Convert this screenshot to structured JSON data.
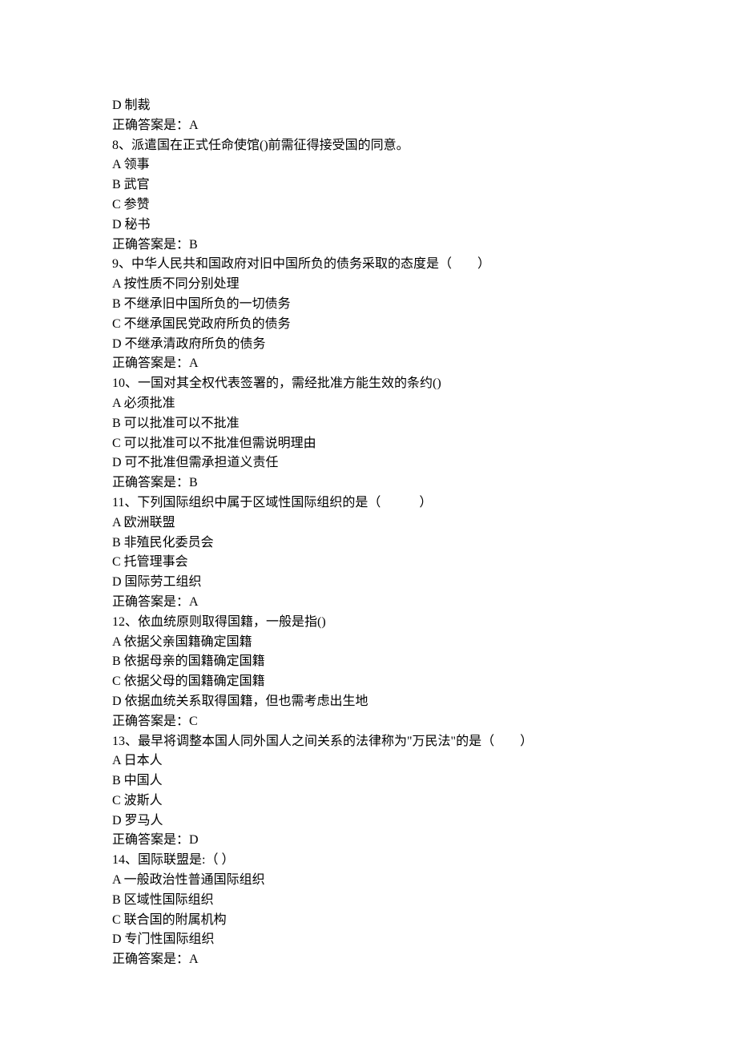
{
  "leading_lines": [
    "D 制裁",
    "正确答案是：A"
  ],
  "questions": [
    {
      "stem": "8、派遣国在正式任命使馆()前需征得接受国的同意。",
      "options": [
        "A 领事",
        "B 武官",
        "C 参赞",
        "D 秘书"
      ],
      "answer": "正确答案是：B"
    },
    {
      "stem": "9、中华人民共和国政府对旧中国所负的债务采取的态度是（　　）",
      "options": [
        "A 按性质不同分别处理",
        "B 不继承旧中国所负的一切债务",
        "C 不继承国民党政府所负的债务",
        "D 不继承清政府所负的债务"
      ],
      "answer": "正确答案是：A"
    },
    {
      "stem": "10、一国对其全权代表签署的，需经批准方能生效的条约()",
      "options": [
        "A 必须批准",
        "B 可以批准可以不批准",
        "C 可以批准可以不批准但需说明理由",
        "D 可不批准但需承担道义责任"
      ],
      "answer": "正确答案是：B"
    },
    {
      "stem": "11、下列国际组织中属于区域性国际组织的是（　　　）",
      "options": [
        "A 欧洲联盟",
        "B 非殖民化委员会",
        "C 托管理事会",
        "D 国际劳工组织"
      ],
      "answer": "正确答案是：A"
    },
    {
      "stem": "12、依血统原则取得国籍，一般是指()",
      "options": [
        "A 依据父亲国籍确定国籍",
        "B 依据母亲的国籍确定国籍",
        "C 依据父母的国籍确定国籍",
        "D 依据血统关系取得国籍，但也需考虑出生地"
      ],
      "answer": "正确答案是：C"
    },
    {
      "stem": "13、最早将调整本国人同外国人之间关系的法律称为\"万民法\"的是（　　）",
      "options": [
        "A 日本人",
        "B 中国人",
        "C 波斯人",
        "D 罗马人"
      ],
      "answer": "正确答案是：D"
    },
    {
      "stem": "14、国际联盟是:（ ）",
      "options": [
        "A 一般政治性普通国际组织",
        "B 区域性国际组织",
        "C 联合国的附属机构",
        "D 专门性国际组织"
      ],
      "answer": "正确答案是：A"
    }
  ]
}
